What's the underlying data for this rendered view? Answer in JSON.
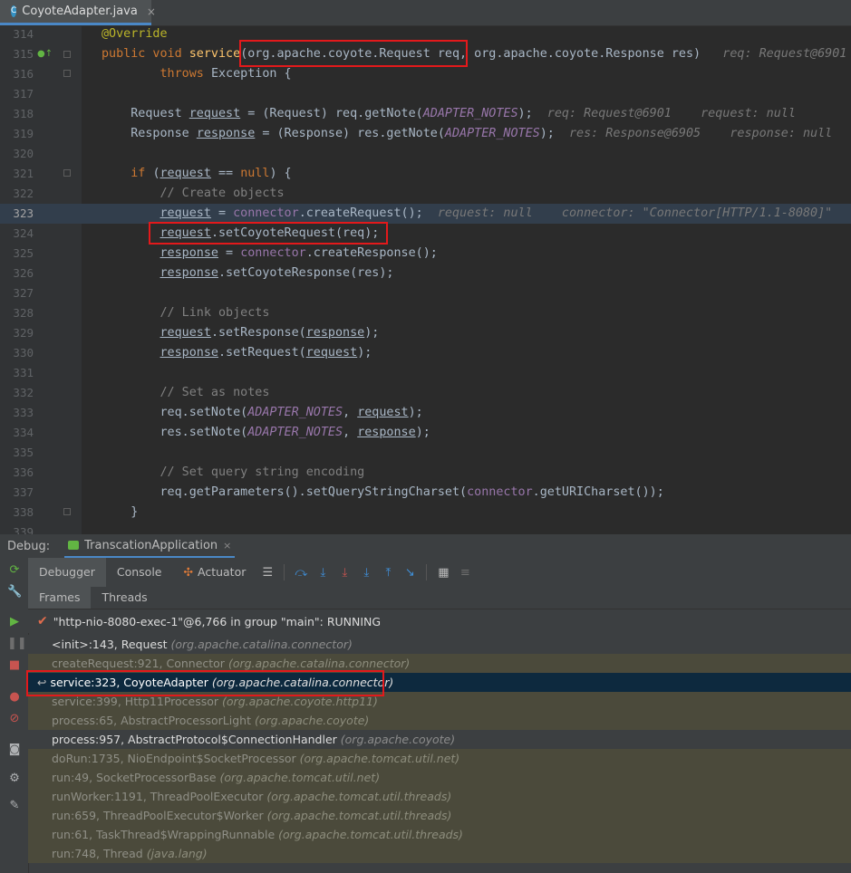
{
  "editor_tab": {
    "icon_letter": "C",
    "label": "CoyoteAdapter.java",
    "close": "×"
  },
  "code_lines": [
    {
      "n": "314",
      "text": "@Override"
    },
    {
      "n": "315",
      "text": "public void service(org.apache.coyote.Request req, org.apache.coyote.Response res)",
      "hint": "req: Request@6901"
    },
    {
      "n": "316",
      "text": "        throws Exception {"
    },
    {
      "n": "317",
      "text": ""
    },
    {
      "n": "318",
      "text": "    Request request = (Request) req.getNote(ADAPTER_NOTES);",
      "hint": "req: Request@6901    request: null"
    },
    {
      "n": "319",
      "text": "    Response response = (Response) res.getNote(ADAPTER_NOTES);",
      "hint": "res: Response@6905    response: null"
    },
    {
      "n": "320",
      "text": ""
    },
    {
      "n": "321",
      "text": "    if (request == null) {"
    },
    {
      "n": "322",
      "text": "        // Create objects"
    },
    {
      "n": "323",
      "text": "        request = connector.createRequest();",
      "hint": "request: null    connector: \"Connector[HTTP/1.1-8080]\""
    },
    {
      "n": "324",
      "text": "        request.setCoyoteRequest(req);"
    },
    {
      "n": "325",
      "text": "        response = connector.createResponse();"
    },
    {
      "n": "326",
      "text": "        response.setCoyoteResponse(res);"
    },
    {
      "n": "327",
      "text": ""
    },
    {
      "n": "328",
      "text": "        // Link objects"
    },
    {
      "n": "329",
      "text": "        request.setResponse(response);"
    },
    {
      "n": "330",
      "text": "        response.setRequest(request);"
    },
    {
      "n": "331",
      "text": ""
    },
    {
      "n": "332",
      "text": "        // Set as notes"
    },
    {
      "n": "333",
      "text": "        req.setNote(ADAPTER_NOTES, request);"
    },
    {
      "n": "334",
      "text": "        res.setNote(ADAPTER_NOTES, response);"
    },
    {
      "n": "335",
      "text": ""
    },
    {
      "n": "336",
      "text": "        // Set query string encoding"
    },
    {
      "n": "337",
      "text": "        req.getParameters().setQueryStringCharset(connector.getURICharset());"
    },
    {
      "n": "338",
      "text": "    }"
    },
    {
      "n": "339",
      "text": ""
    }
  ],
  "debug": {
    "title": "Debug:",
    "app_tab": "TranscationApplication",
    "app_close": "×",
    "tabs": [
      "Debugger",
      "Console",
      "Actuator"
    ],
    "subtabs": [
      "Frames",
      "Threads"
    ],
    "thread_status": "\"http-nio-8080-exec-1\"@6,766 in group \"main\": RUNNING",
    "frames": [
      {
        "method": "<init>:143, Request",
        "pkg": "(org.apache.catalina.connector)",
        "style": "bright"
      },
      {
        "method": "createRequest:921, Connector",
        "pkg": "(org.apache.catalina.connector)",
        "style": "dim"
      },
      {
        "method": "service:323, CoyoteAdapter",
        "pkg": "(org.apache.catalina.connector)",
        "style": "selected"
      },
      {
        "method": "service:399, Http11Processor",
        "pkg": "(org.apache.coyote.http11)",
        "style": "dim"
      },
      {
        "method": "process:65, AbstractProcessorLight",
        "pkg": "(org.apache.coyote)",
        "style": "dim"
      },
      {
        "method": "process:957, AbstractProtocol$ConnectionHandler",
        "pkg": "(org.apache.coyote)",
        "style": "bright"
      },
      {
        "method": "doRun:1735, NioEndpoint$SocketProcessor",
        "pkg": "(org.apache.tomcat.util.net)",
        "style": "dim"
      },
      {
        "method": "run:49, SocketProcessorBase",
        "pkg": "(org.apache.tomcat.util.net)",
        "style": "dim"
      },
      {
        "method": "runWorker:1191, ThreadPoolExecutor",
        "pkg": "(org.apache.tomcat.util.threads)",
        "style": "dim"
      },
      {
        "method": "run:659, ThreadPoolExecutor$Worker",
        "pkg": "(org.apache.tomcat.util.threads)",
        "style": "dim"
      },
      {
        "method": "run:61, TaskThread$WrappingRunnable",
        "pkg": "(org.apache.tomcat.util.threads)",
        "style": "dim"
      },
      {
        "method": "run:748, Thread",
        "pkg": "(java.lang)",
        "style": "dim"
      }
    ]
  }
}
